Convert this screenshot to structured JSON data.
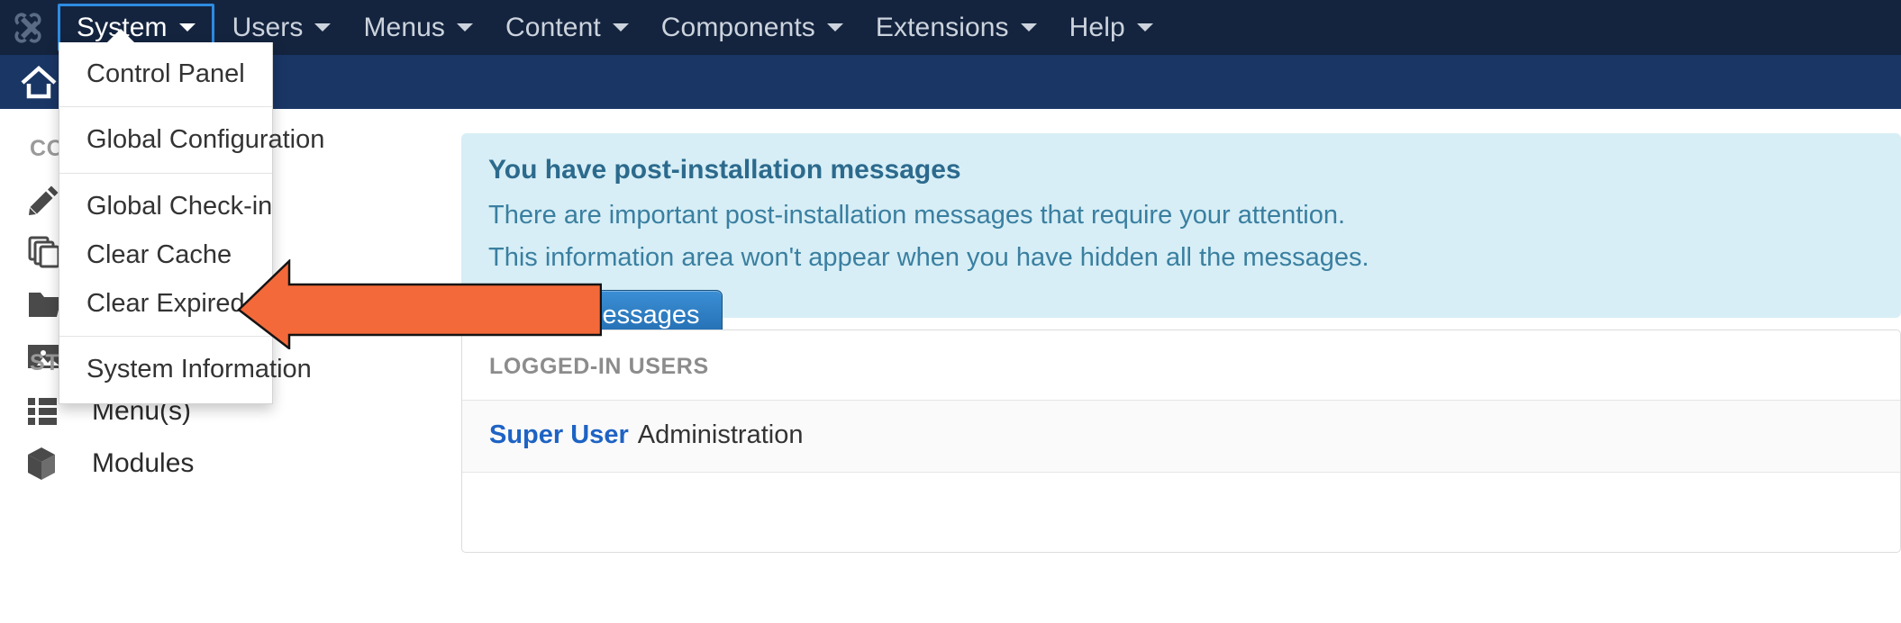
{
  "topbar": {
    "logo_icon": "joomla-logo-icon",
    "menu": [
      {
        "label": "System",
        "icon": "chevron-down-icon",
        "active": true
      },
      {
        "label": "Users",
        "icon": "chevron-down-icon",
        "active": false
      },
      {
        "label": "Menus",
        "icon": "chevron-down-icon",
        "active": false
      },
      {
        "label": "Content",
        "icon": "chevron-down-icon",
        "active": false
      },
      {
        "label": "Components",
        "icon": "chevron-down-icon",
        "active": false
      },
      {
        "label": "Extensions",
        "icon": "chevron-down-icon",
        "active": false
      },
      {
        "label": "Help",
        "icon": "chevron-down-icon",
        "active": false
      }
    ]
  },
  "subheader": {
    "home_icon": "home-icon"
  },
  "dropdown": {
    "owner": "System",
    "items": [
      {
        "label": "Control Panel",
        "separator_after": true
      },
      {
        "label": "Global Configuration",
        "separator_after": true
      },
      {
        "label": "Global Check-in",
        "separator_after": false
      },
      {
        "label": "Clear Cache",
        "separator_after": false
      },
      {
        "label": "Clear Expired Cache",
        "separator_after": true
      },
      {
        "label": "System Information",
        "separator_after": false
      }
    ]
  },
  "annotation": {
    "shape": "left-pointing-arrow",
    "color": "#f4693a",
    "points_at": "System Information"
  },
  "sidebar": {
    "sections": [
      {
        "heading": "CONTENT",
        "heading_truncated": "CO",
        "items": [
          {
            "label": "",
            "icon": "pencil-icon"
          },
          {
            "label": "",
            "icon": "copy-stack-icon"
          },
          {
            "label": "",
            "icon": "folder-icon"
          },
          {
            "label": "",
            "icon": "image-icon"
          }
        ]
      },
      {
        "heading": "STRUCTURE",
        "items": [
          {
            "label": "Menu(s)",
            "icon": "grid-list-icon"
          },
          {
            "label": "Modules",
            "icon": "cube-icon"
          }
        ]
      }
    ]
  },
  "main": {
    "alert": {
      "title": "You have post-installation messages",
      "line1": "There are important post-installation messages that require your attention.",
      "line2": "This information area won't appear when you have hidden all the messages.",
      "button": "Read Messages",
      "bg_color": "#d7eef6",
      "text_color": "#3a7fa0"
    },
    "logged_in_users": {
      "heading": "LOGGED-IN USERS",
      "rows": [
        {
          "name": "Super User",
          "role": "Administration"
        }
      ]
    }
  },
  "colors": {
    "topbar_bg": "#14243f",
    "subheader_bg": "#1a3665",
    "accent_blue": "#2e8be0",
    "link_blue": "#1e63c4",
    "arrow_orange": "#f4693a"
  }
}
